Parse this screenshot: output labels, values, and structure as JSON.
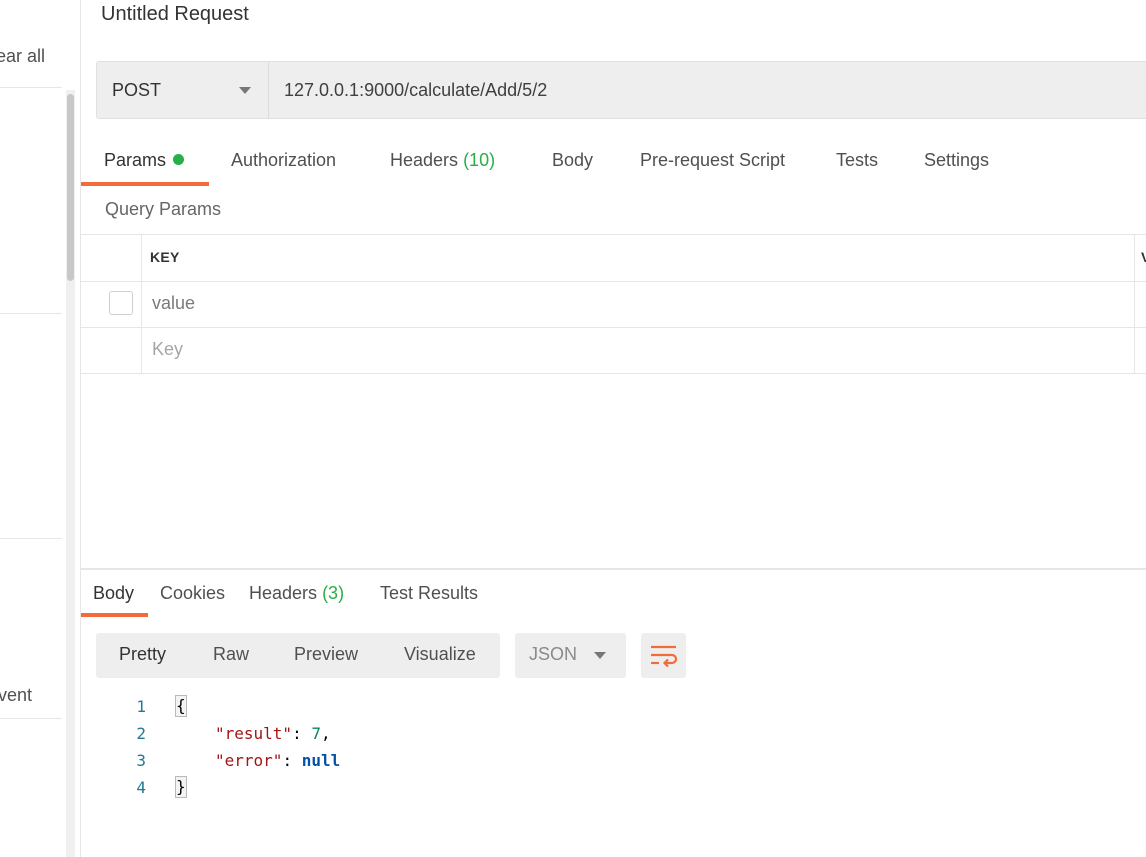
{
  "sidebar": {
    "clear_all_fragment": "ear all",
    "event_fragment": "vent"
  },
  "request": {
    "title": "Untitled Request",
    "method": "POST",
    "url": "127.0.0.1:9000/calculate/Add/5/2"
  },
  "request_tabs": {
    "params": "Params",
    "authorization": "Authorization",
    "headers": "Headers",
    "headers_count": "(10)",
    "body": "Body",
    "prerequest": "Pre-request Script",
    "tests": "Tests",
    "settings": "Settings"
  },
  "query_params": {
    "title": "Query Params",
    "key_header": "KEY",
    "value_header_fragment": "V",
    "rows": [
      {
        "key": "value"
      }
    ],
    "new_row_placeholder": "Key"
  },
  "response_tabs": {
    "body": "Body",
    "cookies": "Cookies",
    "headers": "Headers",
    "headers_count": "(3)",
    "test_results": "Test Results"
  },
  "response_view": {
    "pretty": "Pretty",
    "raw": "Raw",
    "preview": "Preview",
    "visualize": "Visualize",
    "format": "JSON"
  },
  "response_body": {
    "line_numbers": [
      "1",
      "2",
      "3",
      "4"
    ],
    "open_brace": "{",
    "result_key": "\"result\"",
    "result_value": "7",
    "error_key": "\"error\"",
    "error_value": "null",
    "close_brace": "}"
  },
  "colors": {
    "accent": "#f26b3a",
    "count_green": "#26b047",
    "panel_bg": "#eeeeee"
  },
  "icons": {
    "method_caret": "chevron-down-icon",
    "format_caret": "chevron-down-icon",
    "wrap": "wrap-lines-icon"
  }
}
